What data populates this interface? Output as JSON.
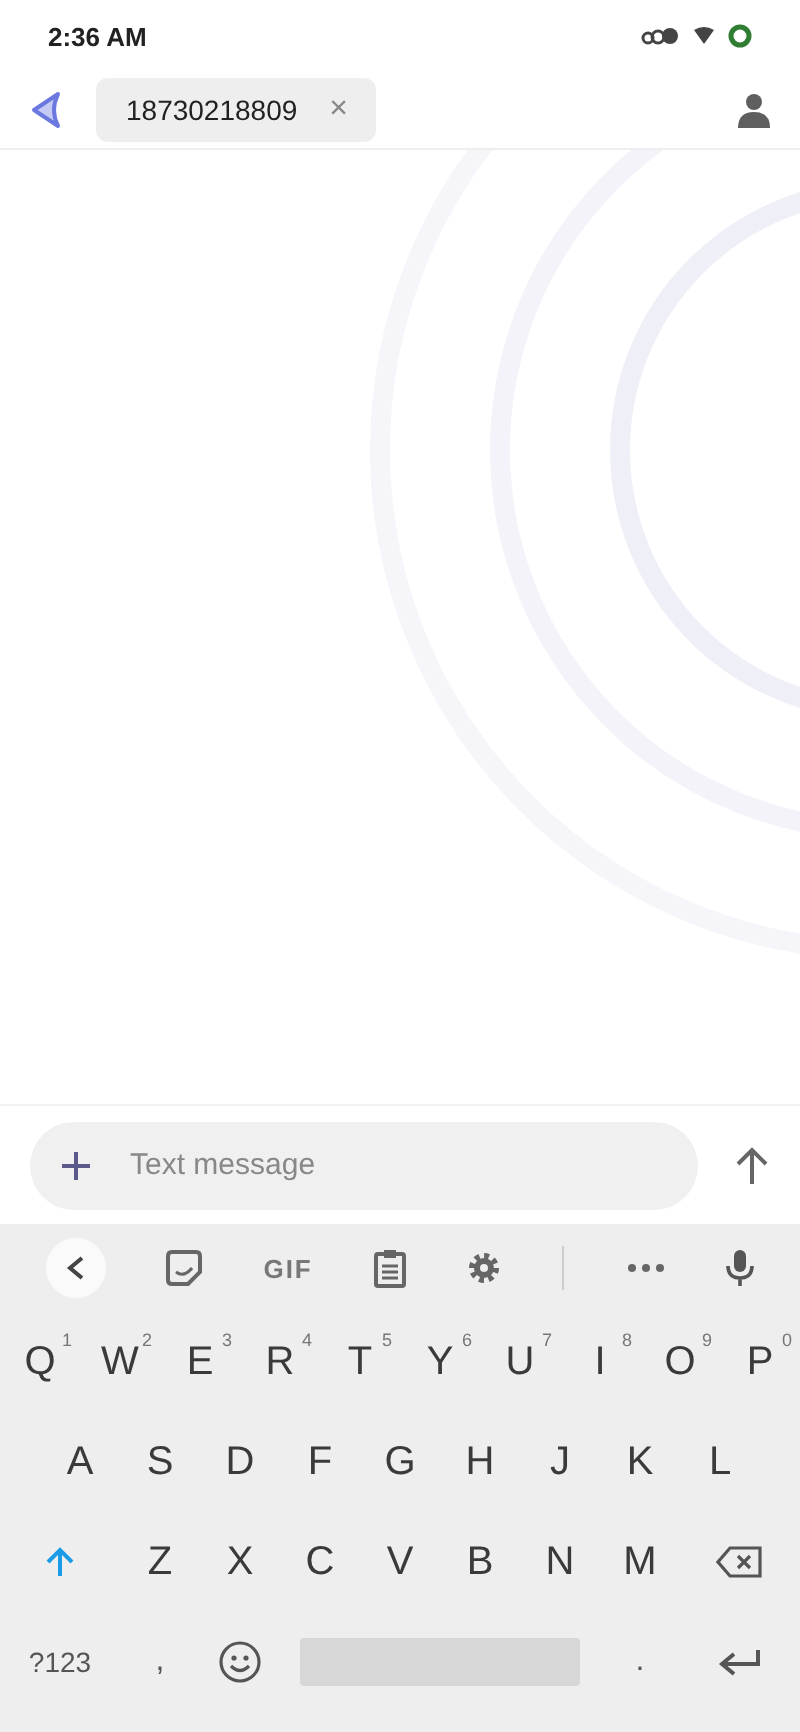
{
  "status_bar": {
    "time": "2:36 AM"
  },
  "header": {
    "recipient_chip": {
      "number": "18730218809",
      "remove_symbol": "×"
    }
  },
  "composer": {
    "placeholder": "Text message"
  },
  "keyboard": {
    "gif_label": "GIF",
    "rows": [
      [
        {
          "key": "Q",
          "hint": "1"
        },
        {
          "key": "W",
          "hint": "2"
        },
        {
          "key": "E",
          "hint": "3"
        },
        {
          "key": "R",
          "hint": "4"
        },
        {
          "key": "T",
          "hint": "5"
        },
        {
          "key": "Y",
          "hint": "6"
        },
        {
          "key": "U",
          "hint": "7"
        },
        {
          "key": "I",
          "hint": "8"
        },
        {
          "key": "O",
          "hint": "9"
        },
        {
          "key": "P",
          "hint": "0"
        }
      ],
      [
        {
          "key": "A"
        },
        {
          "key": "S"
        },
        {
          "key": "D"
        },
        {
          "key": "F"
        },
        {
          "key": "G"
        },
        {
          "key": "H"
        },
        {
          "key": "J"
        },
        {
          "key": "K"
        },
        {
          "key": "L"
        }
      ],
      [
        {
          "key": "Z"
        },
        {
          "key": "X"
        },
        {
          "key": "C"
        },
        {
          "key": "V"
        },
        {
          "key": "B"
        },
        {
          "key": "N"
        },
        {
          "key": "M"
        }
      ]
    ],
    "symbols_key": "?123",
    "comma_key": ",",
    "period_key": "."
  }
}
